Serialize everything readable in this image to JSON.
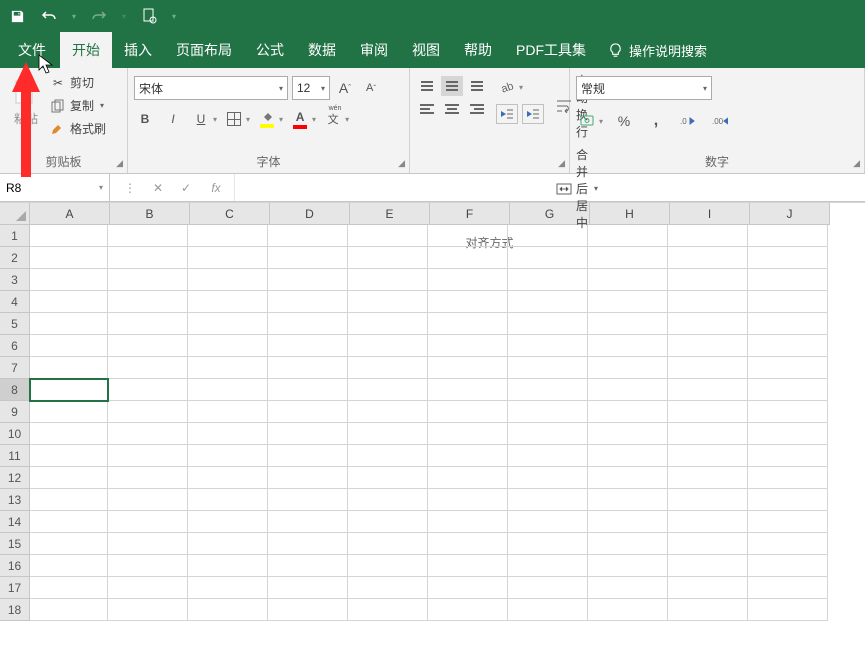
{
  "qat": {
    "save": "save",
    "undo": "undo",
    "redo": "redo",
    "preview": "preview"
  },
  "tabs": {
    "file": "文件",
    "home": "开始",
    "insert": "插入",
    "page_layout": "页面布局",
    "formulas": "公式",
    "data": "数据",
    "review": "审阅",
    "view": "视图",
    "help": "帮助",
    "pdf": "PDF工具集",
    "tell_me": "操作说明搜索"
  },
  "clipboard": {
    "title": "剪贴板",
    "paste": "粘贴",
    "cut": "剪切",
    "copy": "复制",
    "format_painter": "格式刷"
  },
  "font": {
    "title": "字体",
    "name": "宋体",
    "size": "12",
    "grow": "A",
    "shrink": "A",
    "bold": "B",
    "italic": "I",
    "underline": "U"
  },
  "alignment": {
    "title": "对齐方式",
    "wrap": "自动换行",
    "merge": "合并后居中"
  },
  "number": {
    "title": "数字",
    "format": "常规",
    "percent": "%",
    "comma": ","
  },
  "name_box": "R8",
  "columns": [
    "A",
    "B",
    "C",
    "D",
    "E",
    "F",
    "G",
    "H",
    "I",
    "J"
  ],
  "rows": [
    1,
    2,
    3,
    4,
    5,
    6,
    7,
    8,
    9,
    10,
    11,
    12,
    13,
    14,
    15,
    16,
    17,
    18
  ],
  "selected_row": 8
}
